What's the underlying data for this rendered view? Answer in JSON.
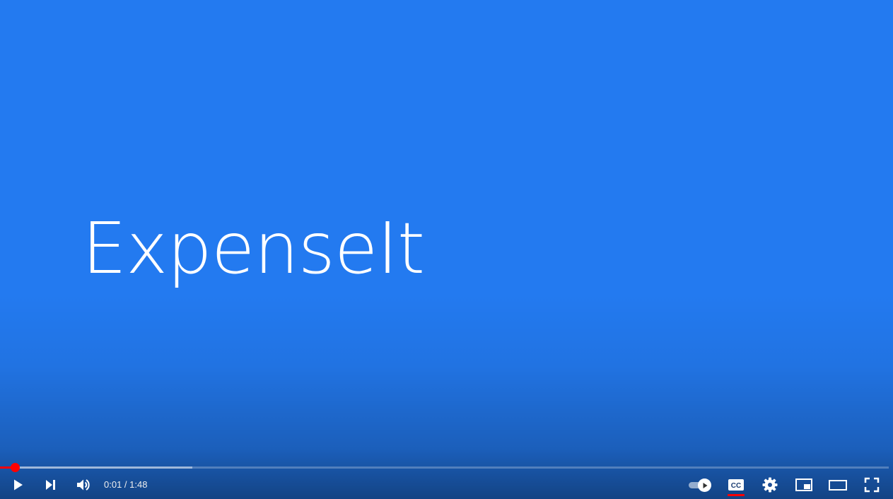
{
  "video": {
    "title_text": "ExpenseIt",
    "background_color": "#237af0"
  },
  "progress": {
    "played_fraction": 0.017,
    "buffered_fraction": 0.216,
    "played_color": "#ff0000"
  },
  "controls": {
    "current_time": "0:01",
    "duration": "1:48",
    "time_display": "0:01 / 1:48",
    "left_icons": [
      "play-icon",
      "next-icon",
      "volume-icon"
    ],
    "right_icons": [
      "autoplay-toggle",
      "captions-icon",
      "settings-icon",
      "miniplayer-icon",
      "theater-mode-icon",
      "fullscreen-icon"
    ],
    "captions_enabled": true,
    "autoplay_enabled": true
  }
}
